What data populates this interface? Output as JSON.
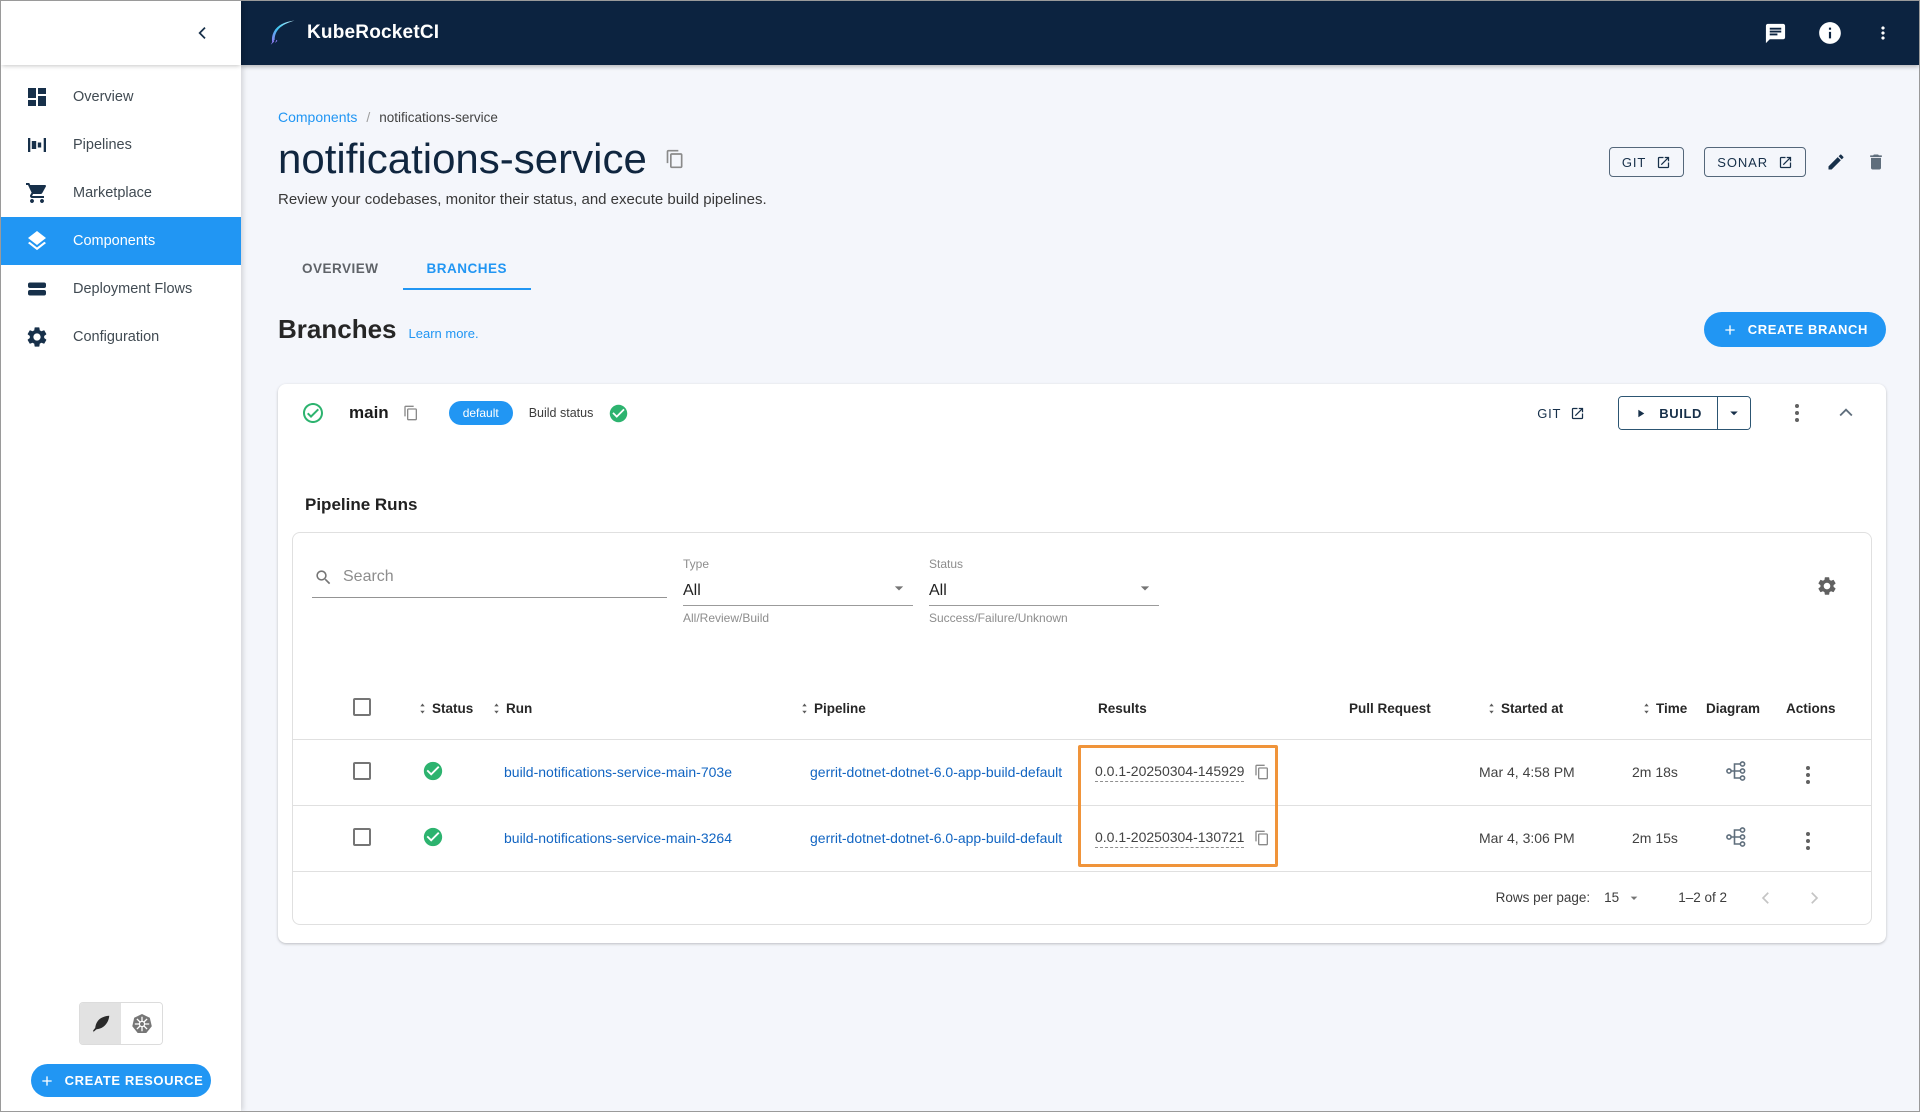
{
  "topbar": {
    "brand": "KubeRocketCI"
  },
  "sidebar": {
    "items": [
      {
        "label": "Overview"
      },
      {
        "label": "Pipelines"
      },
      {
        "label": "Marketplace"
      },
      {
        "label": "Components"
      },
      {
        "label": "Deployment Flows"
      },
      {
        "label": "Configuration"
      }
    ],
    "create_resource_label": "CREATE RESOURCE"
  },
  "header": {
    "breadcrumb": {
      "parent": "Components",
      "separator": "/",
      "current": "notifications-service"
    },
    "title": "notifications-service",
    "subtitle": "Review your codebases, monitor their status, and execute build pipelines.",
    "git_button": "GIT",
    "sonar_button": "SONAR"
  },
  "tabs": {
    "overview": "OVERVIEW",
    "branches": "BRANCHES"
  },
  "branches_section": {
    "heading": "Branches",
    "learn_more": "Learn more.",
    "create_branch_label": "CREATE BRANCH"
  },
  "branch": {
    "name": "main",
    "default_badge": "default",
    "build_status_label": "Build status",
    "git_label": "GIT",
    "build_label": "BUILD"
  },
  "pipeline_runs": {
    "heading": "Pipeline Runs",
    "search_placeholder": "Search",
    "type_filter": {
      "label": "Type",
      "value": "All",
      "helper": "All/Review/Build"
    },
    "status_filter": {
      "label": "Status",
      "value": "All",
      "helper": "Success/Failure/Unknown"
    },
    "table": {
      "columns": [
        {
          "label": "Status"
        },
        {
          "label": "Run"
        },
        {
          "label": "Pipeline"
        },
        {
          "label": "Results"
        },
        {
          "label": "Pull Request"
        },
        {
          "label": "Started at"
        },
        {
          "label": "Time"
        },
        {
          "label": "Diagram"
        },
        {
          "label": "Actions"
        }
      ],
      "rows": [
        {
          "run": "build-notifications-service-main-703e",
          "pipeline": "gerrit-dotnet-dotnet-6.0-app-build-default",
          "result": "0.0.1-20250304-145929",
          "started_at": "Mar 4, 4:58 PM",
          "time": "2m 18s"
        },
        {
          "run": "build-notifications-service-main-3264",
          "pipeline": "gerrit-dotnet-dotnet-6.0-app-build-default",
          "result": "0.0.1-20250304-130721",
          "started_at": "Mar 4, 3:06 PM",
          "time": "2m 15s"
        }
      ]
    },
    "pagination": {
      "rows_per_page_label": "Rows per page:",
      "rows_per_page_value": "15",
      "range_label": "1–2 of 2"
    }
  },
  "colors": {
    "accent": "#2196f3",
    "topbar_bg": "#0c2340",
    "success_green": "#2db36f",
    "annotation_orange": "#f0943a",
    "link_blue": "#1265c2"
  }
}
